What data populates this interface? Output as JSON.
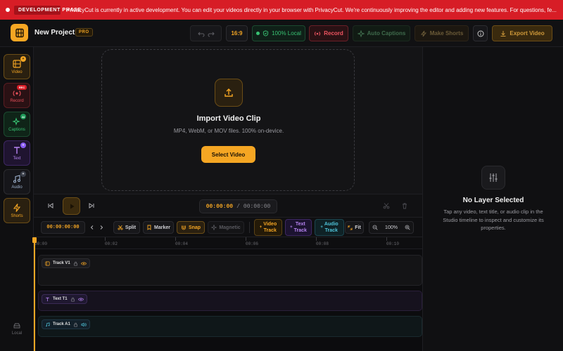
{
  "banner": {
    "badge": "DEVELOPMENT PHASE",
    "message": "PrivacyCut is currently in active development. You can edit your videos directly in your browser with PrivacyCut. We're continuously improving the editor and adding new features. For questions, fe..."
  },
  "header": {
    "project_title": "New Project",
    "pro_badge": "PRO",
    "aspect_ratio": "16:9",
    "local_label": "100% Local",
    "record_label": "Record",
    "captions_label": "Auto Captions",
    "shorts_label": "Make Shorts",
    "export_label": "Export Video"
  },
  "sidebar": {
    "items": [
      {
        "label": "Video",
        "icon": "film-icon"
      },
      {
        "label": "Record",
        "icon": "record-icon",
        "badge": "REC"
      },
      {
        "label": "Captions",
        "icon": "sparkle-icon",
        "badge": "AI"
      },
      {
        "label": "Text",
        "icon": "text-icon",
        "badge": "+"
      },
      {
        "label": "Audio",
        "icon": "music-icon",
        "badge": "+"
      },
      {
        "label": "Shorts",
        "icon": "bolt-icon"
      }
    ],
    "footer_label": "Local"
  },
  "preview": {
    "title": "Import Video Clip",
    "subtitle": "MP4, WebM, or MOV files. 100% on-device.",
    "button": "Select Video"
  },
  "playback": {
    "current_time": "00:00:00",
    "separator": "/",
    "duration": "00:00:00"
  },
  "timeline_toolbar": {
    "timecode": "00:00:00:00",
    "split": "Split",
    "marker": "Marker",
    "snap": "Snap",
    "magnetic": "Magnetic",
    "video_track": [
      "Video",
      "Track"
    ],
    "text_track": [
      "Text",
      "Track"
    ],
    "audio_track": [
      "Audio",
      "Track"
    ],
    "fit": "Fit",
    "zoom": "100%"
  },
  "ruler": {
    "ticks": [
      "00:00",
      "00:02",
      "00:04",
      "00:06",
      "00:08",
      "00:10"
    ]
  },
  "tracks": {
    "video": "Track V1",
    "text": "Text T1",
    "audio": "Track A1"
  },
  "panel": {
    "title": "No Layer Selected",
    "subtitle": "Tap any video, text title, or audio clip in the Studio timeline to inspect and customize its properties."
  },
  "colors": {
    "accent": "#f5a623",
    "banner": "#d71d26",
    "success": "#38c172",
    "danger": "#e8505b",
    "text_purple": "#b784f2",
    "audio_cyan": "#4fc3d9"
  }
}
